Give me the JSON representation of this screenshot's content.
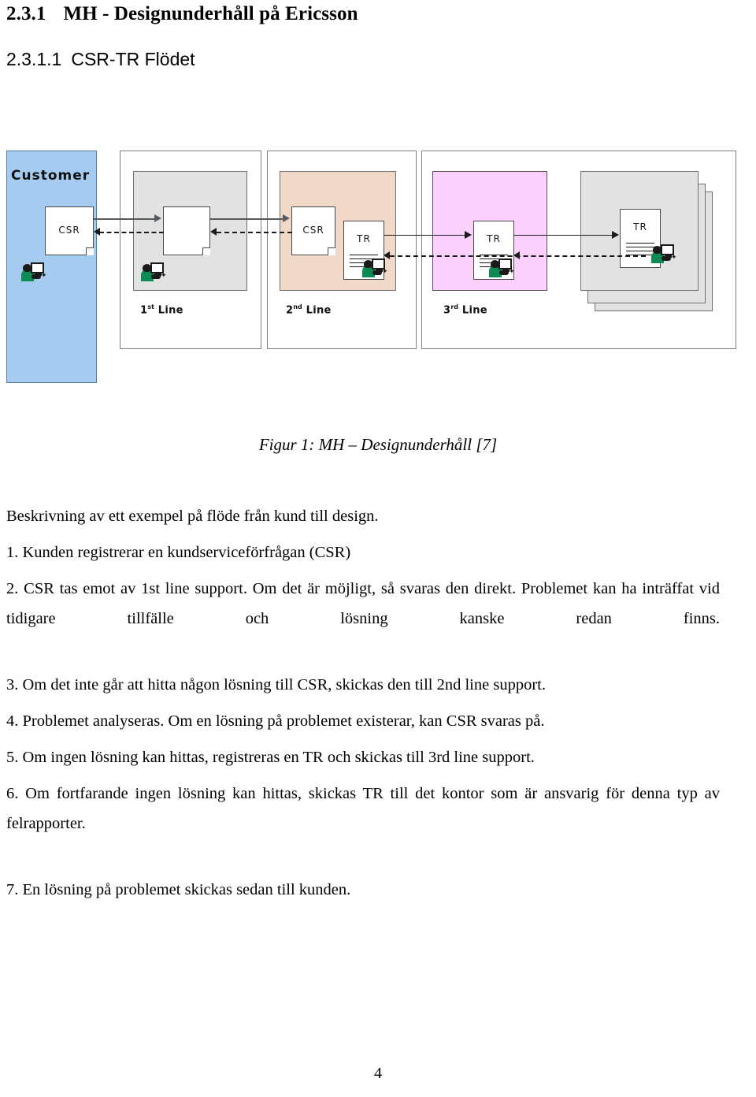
{
  "heading": {
    "number": "2.3.1",
    "title": "MH - Designunderhåll på Ericsson"
  },
  "subheading": {
    "number": "2.3.1.1",
    "title": "CSR-TR Flödet"
  },
  "figure": {
    "customer_lane_label": "Customer",
    "lanes": [
      {
        "label_prefix": "1",
        "label_sup": "st",
        "label_suffix": "Line"
      },
      {
        "label_prefix": "2",
        "label_sup": "nd",
        "label_suffix": "Line"
      },
      {
        "label_prefix": "3",
        "label_sup": "rd",
        "label_suffix": "Line"
      }
    ],
    "documents": {
      "customer_csr": "CSR",
      "first_line_doc": "",
      "second_line_csr": "CSR",
      "second_line_tr": "TR",
      "third_line_tr": "TR",
      "office_tr": "TR"
    },
    "colors": {
      "customer": "#a6cbf0",
      "first_line_inner": "#e2e2e2",
      "second_line_inner": "#f0d9c8",
      "third_line_inner": "#fcd0fc",
      "office_stack": "#e2e2e2",
      "person_shirt": "#0e8a55"
    }
  },
  "caption": "Figur 1: MH – Designunderhåll [7]",
  "body": {
    "intro": "Beskrivning av ett exempel på flöde från kund till design.",
    "items": [
      "1. Kunden registrerar en kundserviceförfrågan (CSR)",
      "2. CSR tas emot av 1st line support. Om det är möjligt, så svaras den direkt. Problemet kan ha inträffat vid tidigare tillfälle och lösning kanske redan finns.",
      "3. Om det inte går att hitta någon lösning till CSR, skickas den till 2nd line support.",
      "4. Problemet analyseras. Om en lösning på problemet existerar, kan CSR svaras på.",
      "5. Om ingen lösning kan hittas, registreras en TR och skickas till 3rd line support.",
      "6. Om fortfarande ingen lösning kan hittas, skickas TR till det kontor som är ansvarig för denna typ av felrapporter.",
      "7. En lösning på problemet skickas sedan till kunden."
    ]
  },
  "page_number": "4"
}
